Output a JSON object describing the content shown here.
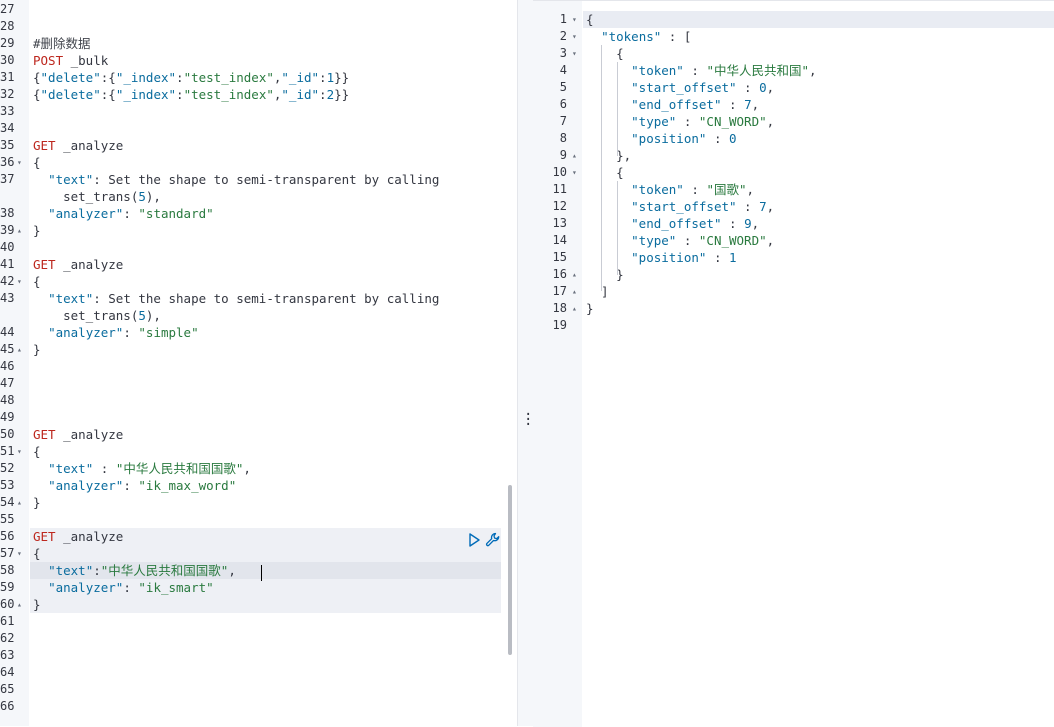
{
  "left_editor": {
    "lines": [
      {
        "n": "27",
        "fold": "",
        "code": ""
      },
      {
        "n": "28",
        "fold": "",
        "code": ""
      },
      {
        "n": "29",
        "fold": "",
        "code": "#删除数据"
      },
      {
        "n": "30",
        "fold": "",
        "code": "POST _bulk"
      },
      {
        "n": "31",
        "fold": "",
        "code": "{\"delete\":{\"_index\":\"test_index\",\"_id\":1}}"
      },
      {
        "n": "32",
        "fold": "",
        "code": "{\"delete\":{\"_index\":\"test_index\",\"_id\":2}}"
      },
      {
        "n": "33",
        "fold": "",
        "code": ""
      },
      {
        "n": "34",
        "fold": "",
        "code": ""
      },
      {
        "n": "35",
        "fold": "",
        "code": "GET _analyze"
      },
      {
        "n": "36",
        "fold": "▾",
        "code": "{"
      },
      {
        "n": "37",
        "fold": "",
        "code": "  \"text\": \"Set the shape to semi-transparent by calling"
      },
      {
        "n": "",
        "fold": "",
        "code": "    set_trans(5)\","
      },
      {
        "n": "38",
        "fold": "",
        "code": "  \"analyzer\": \"standard\""
      },
      {
        "n": "39",
        "fold": "▴",
        "code": "}"
      },
      {
        "n": "40",
        "fold": "",
        "code": ""
      },
      {
        "n": "41",
        "fold": "",
        "code": "GET _analyze"
      },
      {
        "n": "42",
        "fold": "▾",
        "code": "{"
      },
      {
        "n": "43",
        "fold": "",
        "code": "  \"text\": \"Set the shape to semi-transparent by calling"
      },
      {
        "n": "",
        "fold": "",
        "code": "    set_trans(5)\","
      },
      {
        "n": "44",
        "fold": "",
        "code": "  \"analyzer\": \"simple\""
      },
      {
        "n": "45",
        "fold": "▴",
        "code": "}"
      },
      {
        "n": "46",
        "fold": "",
        "code": ""
      },
      {
        "n": "47",
        "fold": "",
        "code": ""
      },
      {
        "n": "48",
        "fold": "",
        "code": ""
      },
      {
        "n": "49",
        "fold": "",
        "code": ""
      },
      {
        "n": "50",
        "fold": "",
        "code": "GET _analyze"
      },
      {
        "n": "51",
        "fold": "▾",
        "code": "{"
      },
      {
        "n": "52",
        "fold": "",
        "code": "  \"text\" : \"中华人民共和国国歌\","
      },
      {
        "n": "53",
        "fold": "",
        "code": "  \"analyzer\": \"ik_max_word\""
      },
      {
        "n": "54",
        "fold": "▴",
        "code": "}"
      },
      {
        "n": "55",
        "fold": "",
        "code": ""
      },
      {
        "n": "56",
        "fold": "",
        "code": "GET _analyze"
      },
      {
        "n": "57",
        "fold": "▾",
        "code": "{"
      },
      {
        "n": "58",
        "fold": "",
        "code": "  \"text\":\"中华人民共和国国歌\","
      },
      {
        "n": "59",
        "fold": "",
        "code": "  \"analyzer\": \"ik_smart\""
      },
      {
        "n": "60",
        "fold": "▴",
        "code": "}"
      },
      {
        "n": "61",
        "fold": "",
        "code": ""
      },
      {
        "n": "62",
        "fold": "",
        "code": ""
      },
      {
        "n": "63",
        "fold": "",
        "code": ""
      },
      {
        "n": "64",
        "fold": "",
        "code": ""
      },
      {
        "n": "65",
        "fold": "",
        "code": ""
      },
      {
        "n": "66",
        "fold": "",
        "code": ""
      }
    ]
  },
  "right_editor": {
    "lines": [
      {
        "n": "1",
        "fold": "▾",
        "code": "{"
      },
      {
        "n": "2",
        "fold": "▾",
        "code": "  \"tokens\" : ["
      },
      {
        "n": "3",
        "fold": "▾",
        "code": "    {"
      },
      {
        "n": "4",
        "fold": "",
        "code": "      \"token\" : \"中华人民共和国\","
      },
      {
        "n": "5",
        "fold": "",
        "code": "      \"start_offset\" : 0,"
      },
      {
        "n": "6",
        "fold": "",
        "code": "      \"end_offset\" : 7,"
      },
      {
        "n": "7",
        "fold": "",
        "code": "      \"type\" : \"CN_WORD\","
      },
      {
        "n": "8",
        "fold": "",
        "code": "      \"position\" : 0"
      },
      {
        "n": "9",
        "fold": "▴",
        "code": "    },"
      },
      {
        "n": "10",
        "fold": "▾",
        "code": "    {"
      },
      {
        "n": "11",
        "fold": "",
        "code": "      \"token\" : \"国歌\","
      },
      {
        "n": "12",
        "fold": "",
        "code": "      \"start_offset\" : 7,"
      },
      {
        "n": "13",
        "fold": "",
        "code": "      \"end_offset\" : 9,"
      },
      {
        "n": "14",
        "fold": "",
        "code": "      \"type\" : \"CN_WORD\","
      },
      {
        "n": "15",
        "fold": "",
        "code": "      \"position\" : 1"
      },
      {
        "n": "16",
        "fold": "▴",
        "code": "    }"
      },
      {
        "n": "17",
        "fold": "▴",
        "code": "  ]"
      },
      {
        "n": "18",
        "fold": "▴",
        "code": "}"
      },
      {
        "n": "19",
        "fold": "",
        "code": ""
      }
    ]
  },
  "icons": {
    "run": "play-icon",
    "wrench": "wrench-icon",
    "splitter": "vertical-dots-icon"
  },
  "colors": {
    "method": "#bd271e",
    "key": "#0a6c9e",
    "string": "#2a7a3f"
  }
}
